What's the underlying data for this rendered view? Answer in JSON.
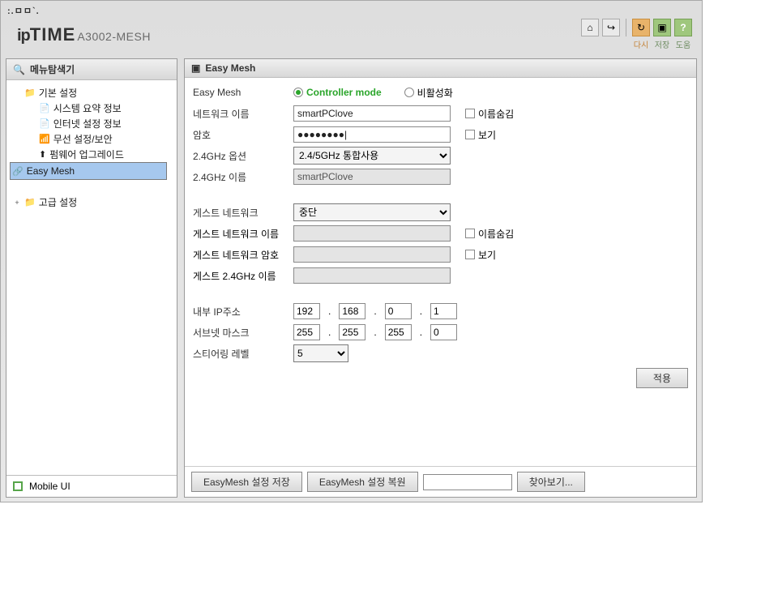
{
  "titlebar_dots": ":.ㅁㅁ`.",
  "logo": {
    "ip": "ip",
    "time": "TIME",
    "model": "A3002-MESH"
  },
  "toolbar": {
    "home_title": "홈",
    "logout_title": "로그아웃",
    "refresh": "다시",
    "save": "저장",
    "help": "도움"
  },
  "sidebar": {
    "title": "메뉴탐색기",
    "root1": "기본 설정",
    "items": [
      "시스템 요약 정보",
      "인터넷 설정 정보",
      "무선 설정/보안",
      "펌웨어 업그레이드",
      "Easy Mesh"
    ],
    "root2": "고급 설정",
    "mobile": "Mobile UI"
  },
  "main": {
    "title": "Easy Mesh",
    "easy_mesh_label": "Easy Mesh",
    "controller_mode": "Controller mode",
    "disabled": "비활성화",
    "network_name_label": "네트워크 이름",
    "network_name_value": "smartPClove",
    "hide_name": "이름숨김",
    "password_label": "암호",
    "password_value": "●●●●●●●●|",
    "show": "보기",
    "opt24_label": "2.4GHz 옵션",
    "opt24_value": "2.4/5GHz 통합사용",
    "name24_label": "2.4GHz 이름",
    "name24_value": "smartPClove",
    "guest_net_label": "게스트 네트워크",
    "guest_net_value": "중단",
    "guest_name_label": "게스트 네트워크 이름",
    "guest_hide": "이름숨김",
    "guest_pass_label": "게스트 네트워크 암호",
    "guest_show": "보기",
    "guest24_label": "게스트 2.4GHz 이름",
    "ip_label": "내부 IP주소",
    "ip": [
      "192",
      "168",
      "0",
      "1"
    ],
    "subnet_label": "서브넷 마스크",
    "subnet": [
      "255",
      "255",
      "255",
      "0"
    ],
    "steer_label": "스티어링 레벨",
    "steer_value": "5",
    "apply": "적용",
    "save_settings": "EasyMesh 설정 저장",
    "restore_settings": "EasyMesh 설정 복원",
    "browse": "찾아보기..."
  }
}
